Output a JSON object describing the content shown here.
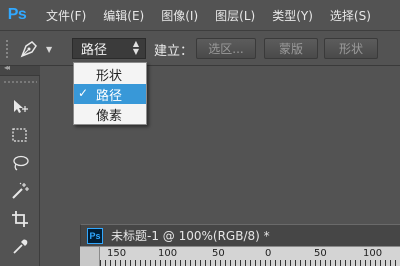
{
  "app": {
    "logo_text": "Ps"
  },
  "menubar": {
    "items": [
      "文件(F)",
      "编辑(E)",
      "图像(I)",
      "图层(L)",
      "类型(Y)",
      "选择(S)"
    ]
  },
  "options_bar": {
    "tool_icon": "pen-tool-icon",
    "mode_value": "路径",
    "build_label": "建立：",
    "buttons": [
      "选区...",
      "蒙版",
      "形状"
    ]
  },
  "mode_dropdown": {
    "options": [
      "形状",
      "路径",
      "像素"
    ],
    "selected": "路径",
    "check_mark": "✓"
  },
  "toolbox": {
    "collapse_glyph": "◂◂",
    "tools": [
      "move-tool-icon",
      "marquee-tool-icon",
      "lasso-tool-icon",
      "magic-wand-tool-icon",
      "crop-tool-icon",
      "eyedropper-tool-icon"
    ]
  },
  "document": {
    "icon_text": "Ps",
    "title": "未标题-1 @ 100%(RGB/8) *"
  },
  "ruler": {
    "labels": [
      "150",
      "100",
      "50",
      "0",
      "50",
      "100",
      "150"
    ]
  },
  "colors": {
    "accent": "#31a8ff",
    "selection": "#3898d8",
    "chrome": "#535353"
  }
}
